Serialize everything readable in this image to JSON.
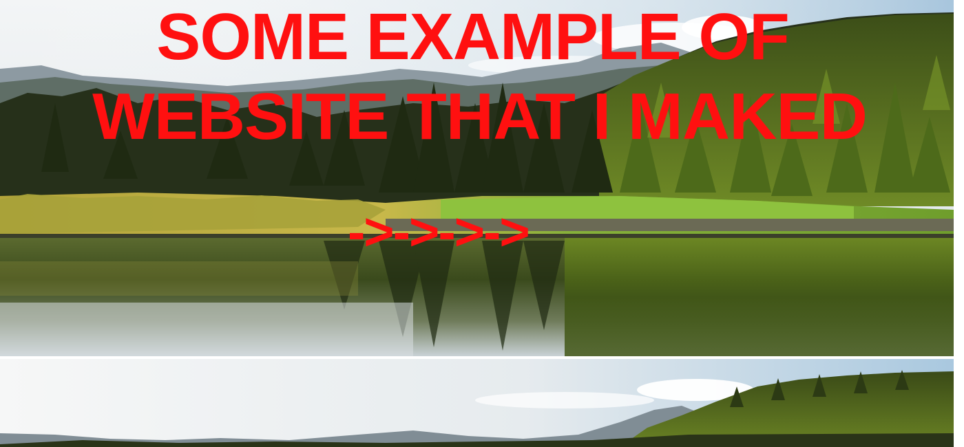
{
  "headline": {
    "line1": "SOME EXAMPLE OF",
    "line2": "WEBSITE THAT I MAKED",
    "arrows": "->->->->",
    "color": "#ff1010"
  },
  "scene": {
    "description_icon": "landscape-photo",
    "sky_color": "#dfe7ee",
    "forest_color": "#2f3a14",
    "grass_color": "#7da63a",
    "water_color": "#4a5a2a"
  }
}
